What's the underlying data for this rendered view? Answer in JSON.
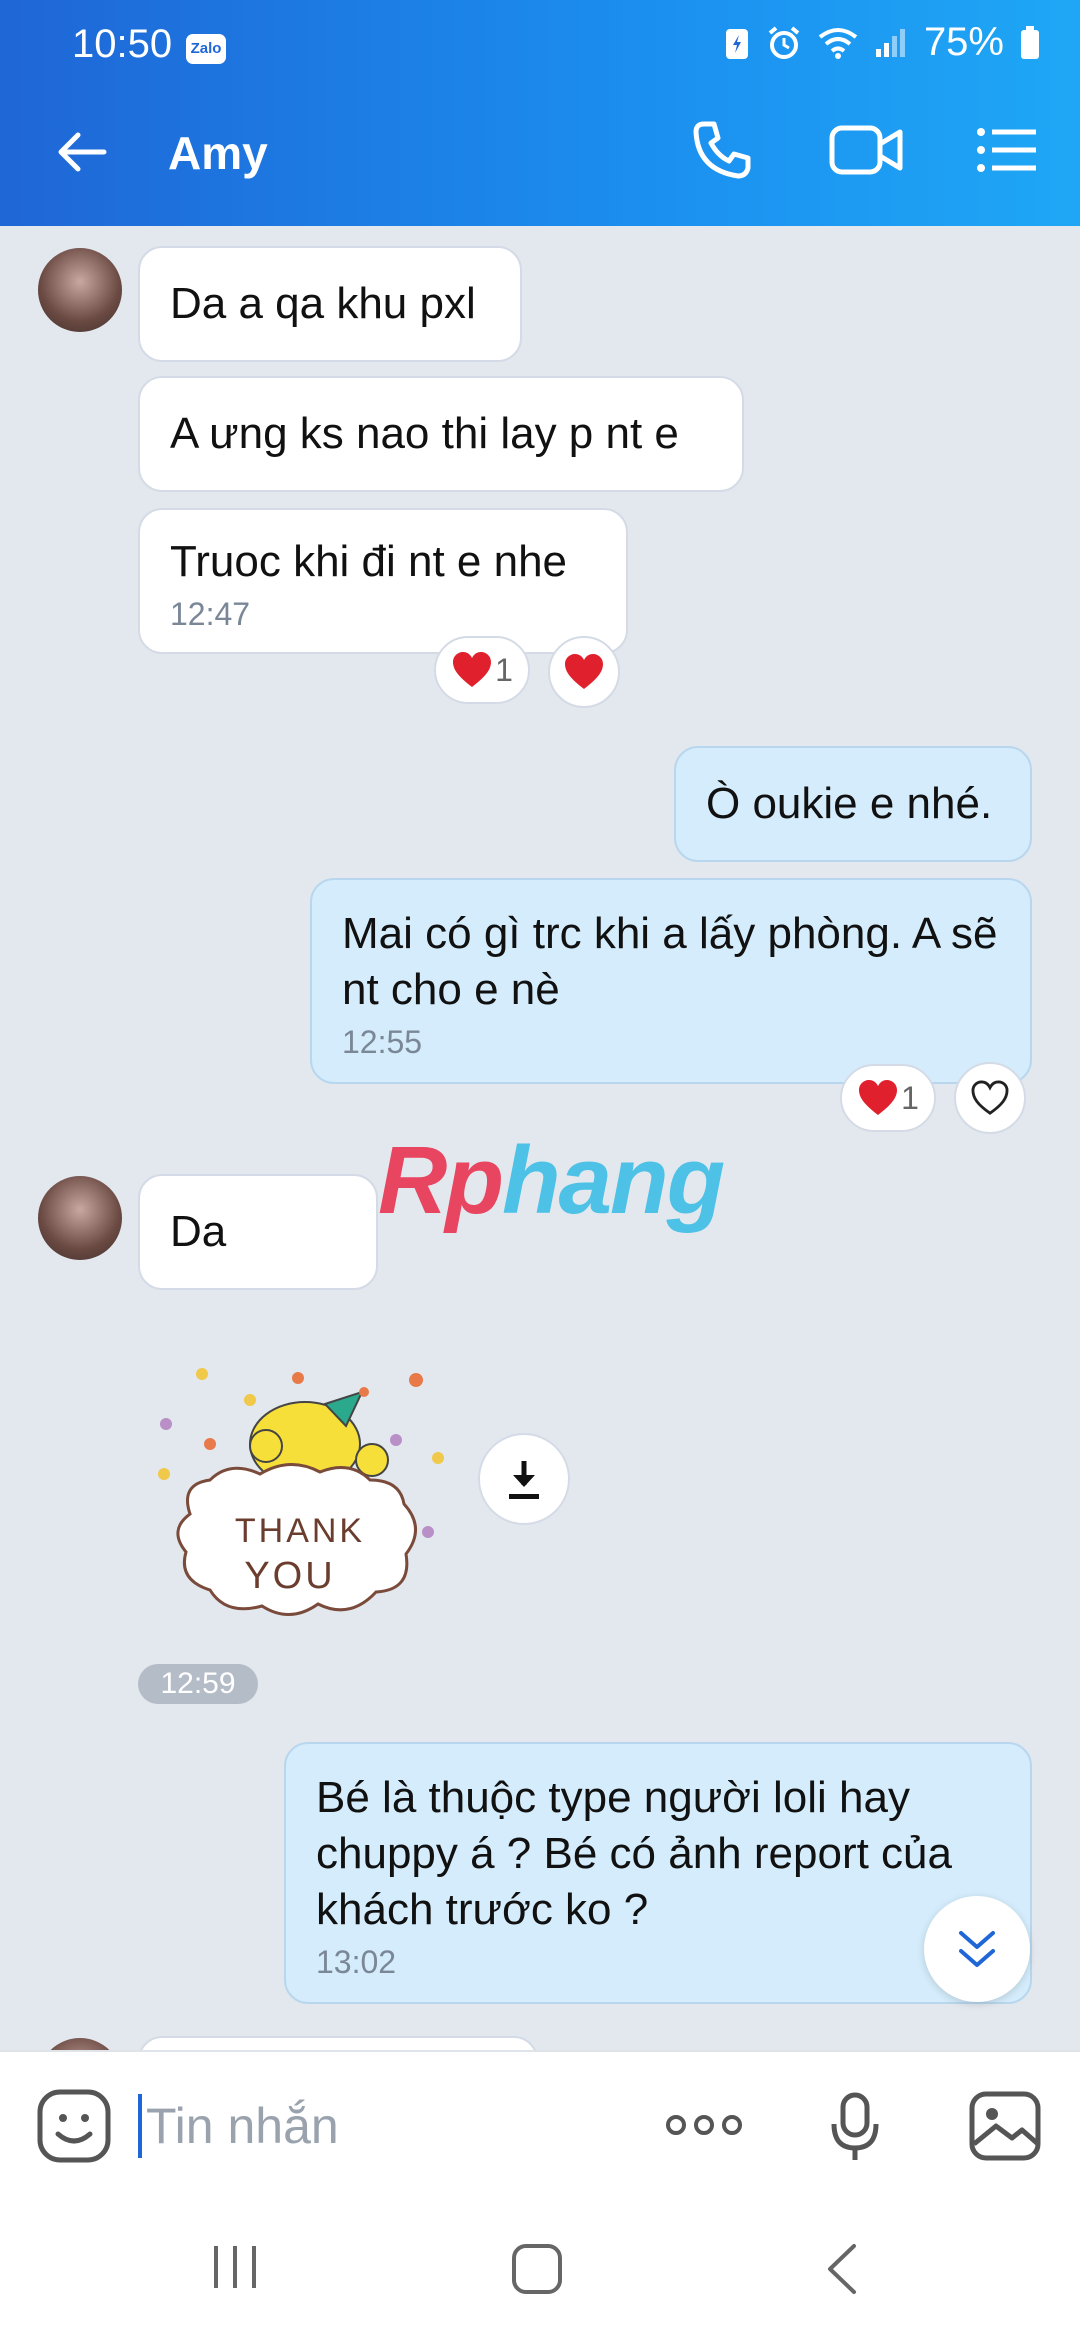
{
  "status": {
    "time": "10:50",
    "app_badge": "Zalo",
    "battery": "75%"
  },
  "header": {
    "title": "Amy"
  },
  "messages": {
    "m1": {
      "text": "Da a qa khu pxl"
    },
    "m2": {
      "text": "A ưng ks nao thi lay p nt e"
    },
    "m3": {
      "text": "Truoc khi đi nt e nhe",
      "time": "12:47",
      "reaction_count": "1"
    },
    "m4": {
      "text": "Ò oukie e nhé."
    },
    "m5": {
      "text": "Mai có gì trc khi a lấy phòng. A sẽ nt cho e nè",
      "time": "12:55",
      "reaction_count": "1"
    },
    "m6": {
      "text": "Da"
    },
    "sticker": {
      "line1": "THANK",
      "line2": "YOU",
      "time": "12:59"
    },
    "m7": {
      "text": "Bé là thuộc type người loli hay chuppy á ? Bé có ảnh report của khách trước ko ?",
      "time": "13:02"
    }
  },
  "watermark": {
    "part1": "Rp",
    "part2": "hang"
  },
  "input": {
    "placeholder": "Tin nhắn"
  }
}
